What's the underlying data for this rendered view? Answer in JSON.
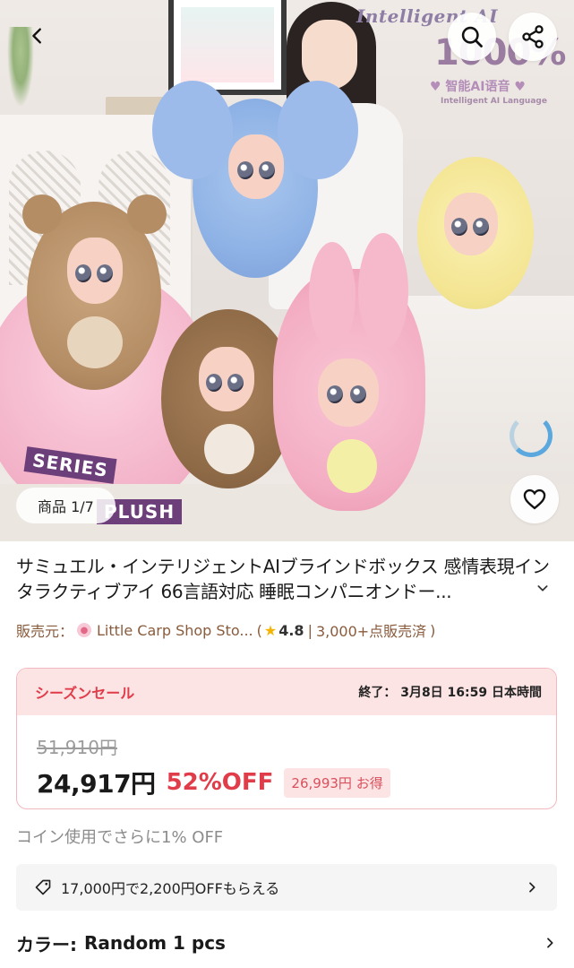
{
  "hero": {
    "promo_line1": "Intelligent AI",
    "promo_big": "1000%",
    "promo_lang": "♥ 智能AI语音 ♥",
    "promo_sub": "Intelligent AI Language",
    "series_label": "SERIES",
    "plush_label": "PLUSH",
    "image_counter": "商品 1/7"
  },
  "product": {
    "title": "サミュエル・インテリジェントAIブラインドボックス 感情表現インタラクティブアイ 66言語対応 睡眠コンパニオンドー..."
  },
  "seller": {
    "prefix": "販売元：",
    "store_name": "Little Carp Shop Sto...",
    "open_paren": "(",
    "rating": "4.8",
    "separator": "|",
    "sold": "3,000+点販売済",
    "close_paren": ")"
  },
  "sale": {
    "label": "シーズンセール",
    "end_text": "終了： 3月8日 16:59 日本時間",
    "original_price": "51,910円",
    "price": "24,917円",
    "discount": "52%OFF",
    "savings_amount": "26,993円",
    "savings_label": "お得"
  },
  "coin_note": "コイン使用でさらに1% OFF",
  "coupon": {
    "text": "17,000円で2,200円OFFもらえる"
  },
  "color_option": {
    "label": "カラー:",
    "value": "Random 1 pcs"
  },
  "icons": {
    "back": "back-arrow-icon",
    "search": "search-icon",
    "share": "share-icon",
    "favorite": "heart-icon",
    "loading": "loading-spinner-icon",
    "coupon": "tag-icon",
    "chevron": "chevron-right-icon",
    "expand": "chevron-down-icon"
  },
  "colors": {
    "sale_red": "#e03c49",
    "sale_bg": "#fde4e4",
    "seller_brown": "#8a5b3c",
    "spinner_blue": "#5ba8de"
  }
}
